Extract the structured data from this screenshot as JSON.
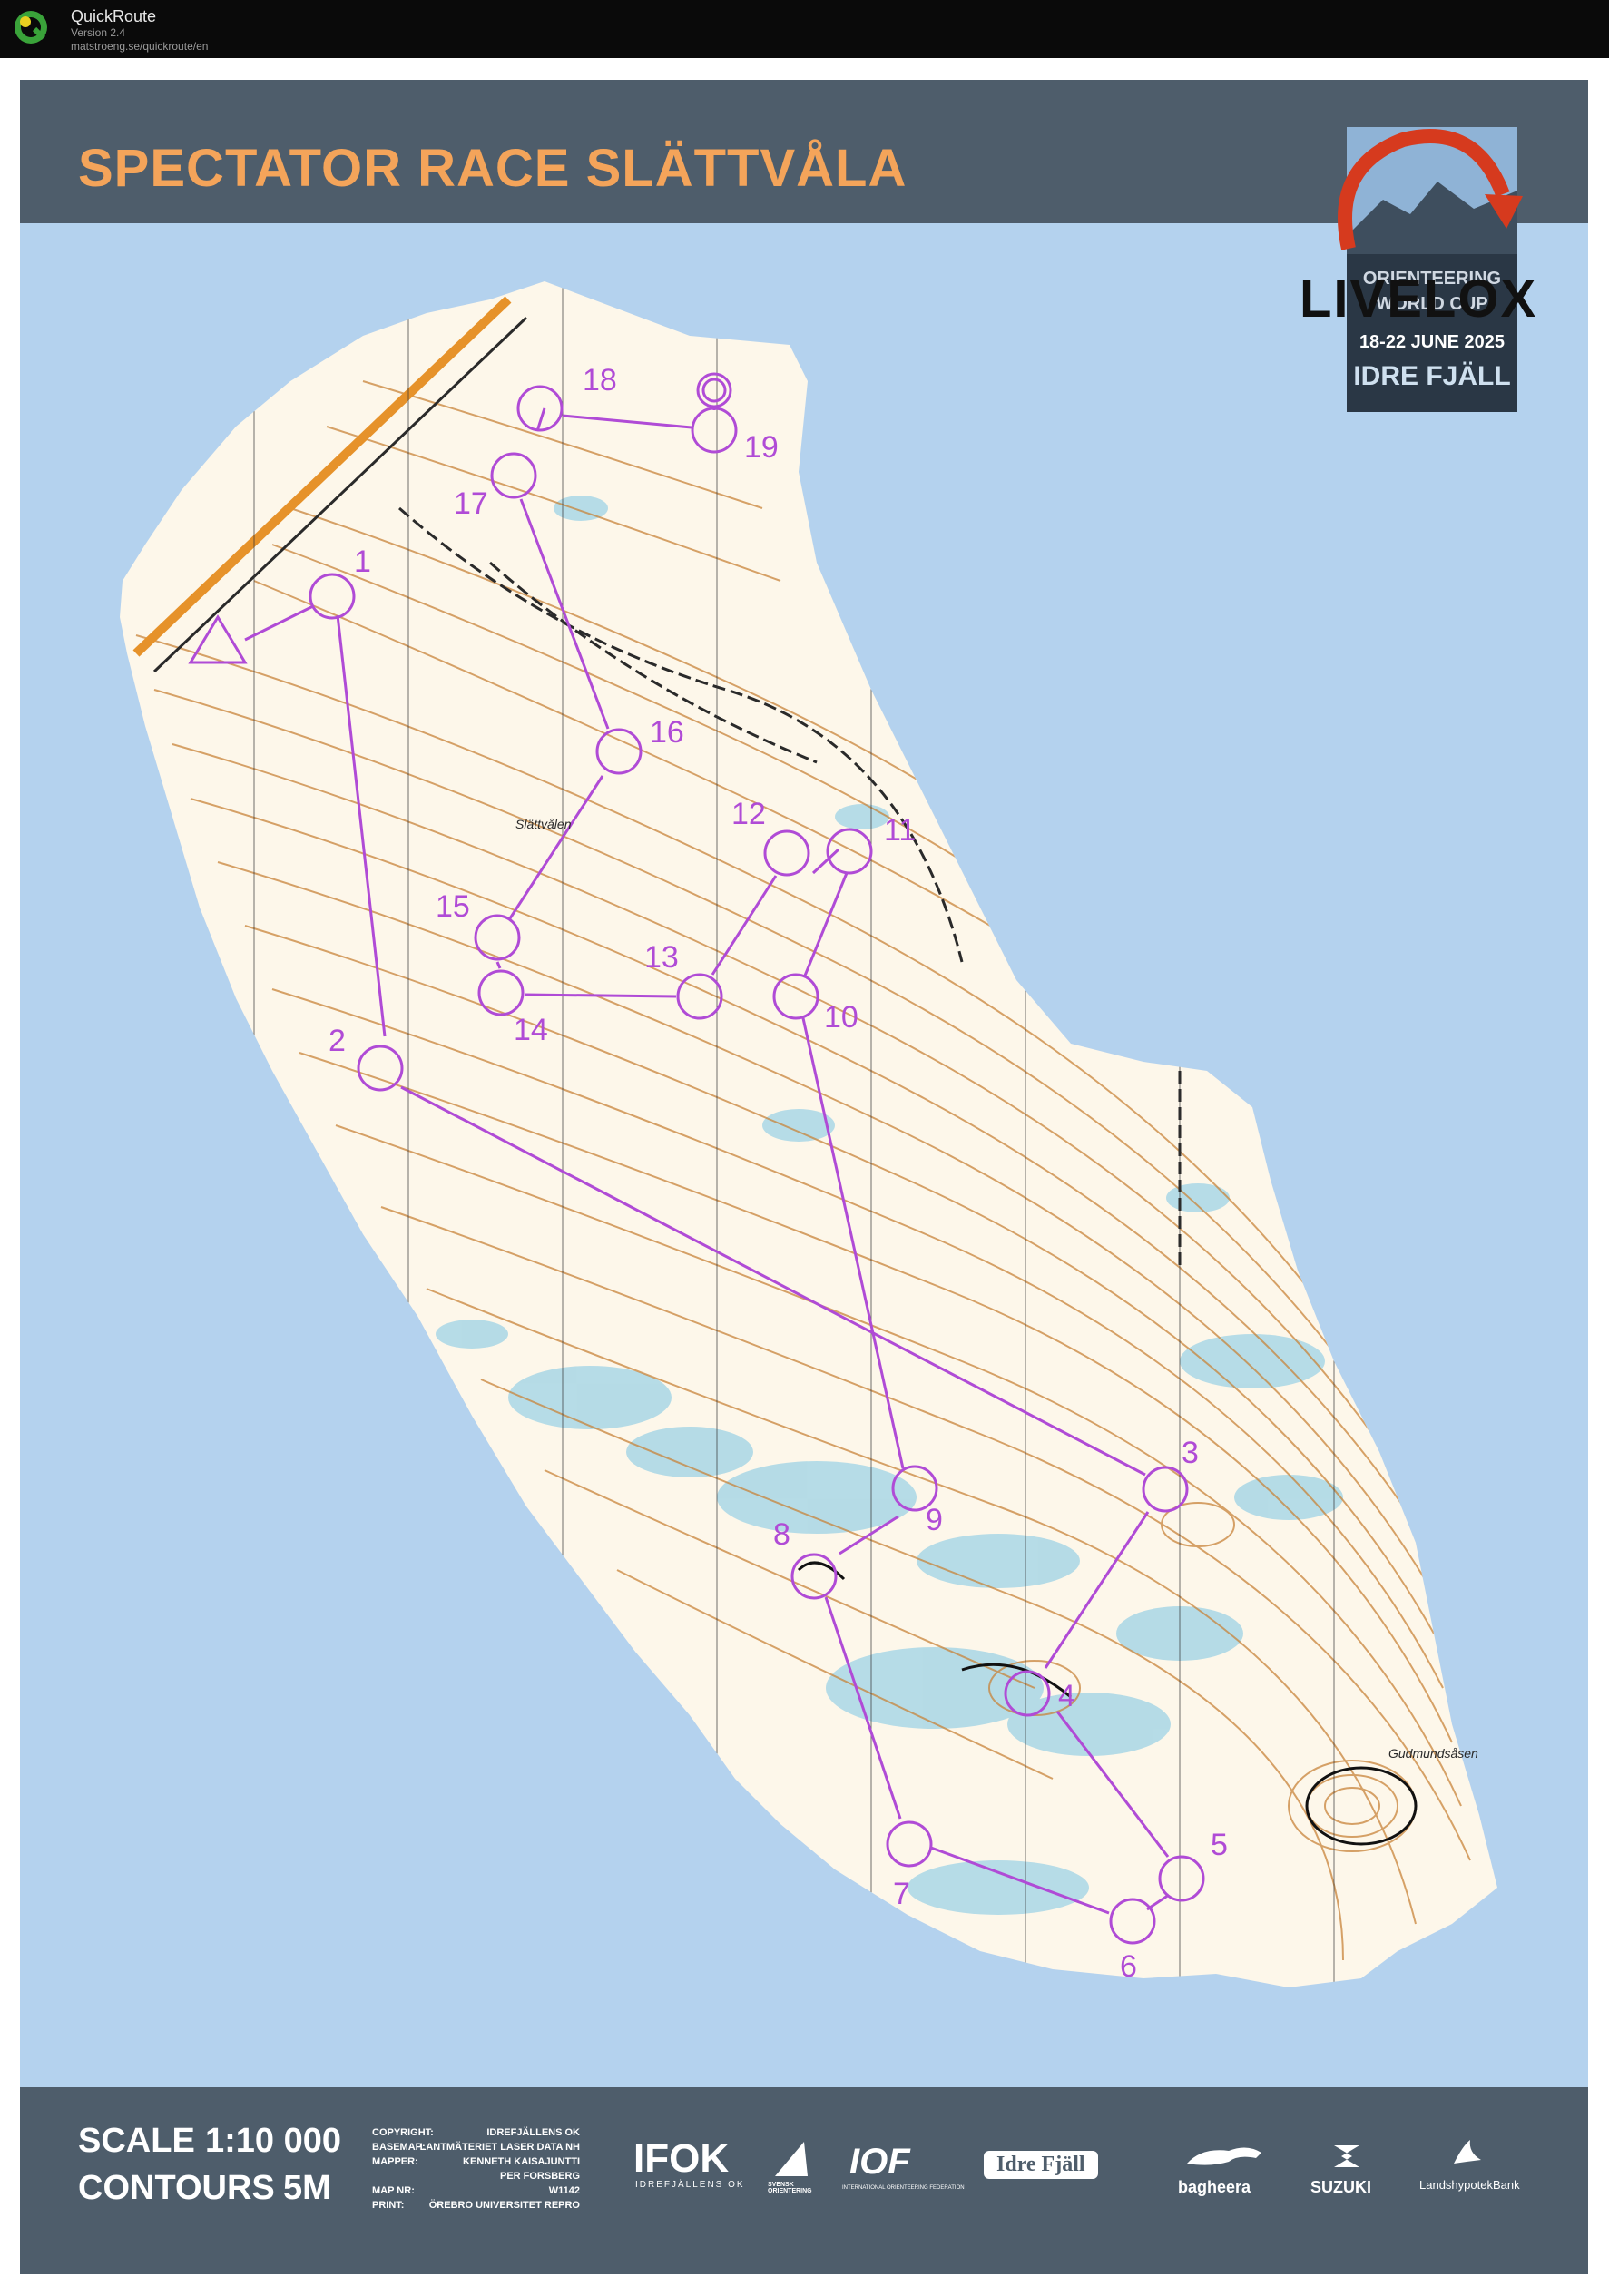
{
  "app": {
    "name": "QuickRoute",
    "version": "Version 2.4",
    "url": "matstroeng.se/quickroute/en"
  },
  "map": {
    "title": "SPECTATOR RACE  SLÄTTVÅLA",
    "scale_label": "SCALE",
    "scale_value": "1:10 000",
    "contours_label": "CONTOURS",
    "contours_value": "5M",
    "place_names": [
      "Slättvålen",
      "Gudmundsåsen"
    ],
    "credits": [
      {
        "key": "COPYRIGHT:",
        "value": "IDREFJÄLLENS OK"
      },
      {
        "key": "BASEMAP:",
        "value": "LANTMÄTERIET LASER DATA NH"
      },
      {
        "key": "MAPPER:",
        "value": "KENNETH KAISAJUNTTI"
      },
      {
        "key": "",
        "value": "PER FORSBERG"
      },
      {
        "key": "MAP NR:",
        "value": "W1142"
      },
      {
        "key": "PRINT:",
        "value": "ÖREBRO UNIVERSITET REPRO"
      }
    ],
    "sponsors": [
      "IFOK",
      "IDREFJÄLLENS OK",
      "SVENSK ORIENTERING",
      "IOF",
      "INTERNATIONAL ORIENTEERING FEDERATION",
      "Idre Fjäll",
      "bagheera",
      "SUZUKI",
      "LandshypotekBank"
    ],
    "event_badge": {
      "line1": "ORIENTEERING",
      "line2": "WORLD CUP",
      "dates": "18-22 JUNE 2025",
      "venue": "IDRE FJÄLL"
    },
    "overlay_logo": "LIVELOX",
    "colors": {
      "course": "#b04bd6",
      "sea": "#b4d2ee",
      "header": "#4e5d6b",
      "title": "#f4a45a",
      "contour": "#c8843a"
    },
    "controls": [
      "1",
      "2",
      "3",
      "4",
      "5",
      "6",
      "7",
      "8",
      "9",
      "10",
      "11",
      "12",
      "13",
      "14",
      "15",
      "16",
      "17",
      "18",
      "19"
    ]
  }
}
